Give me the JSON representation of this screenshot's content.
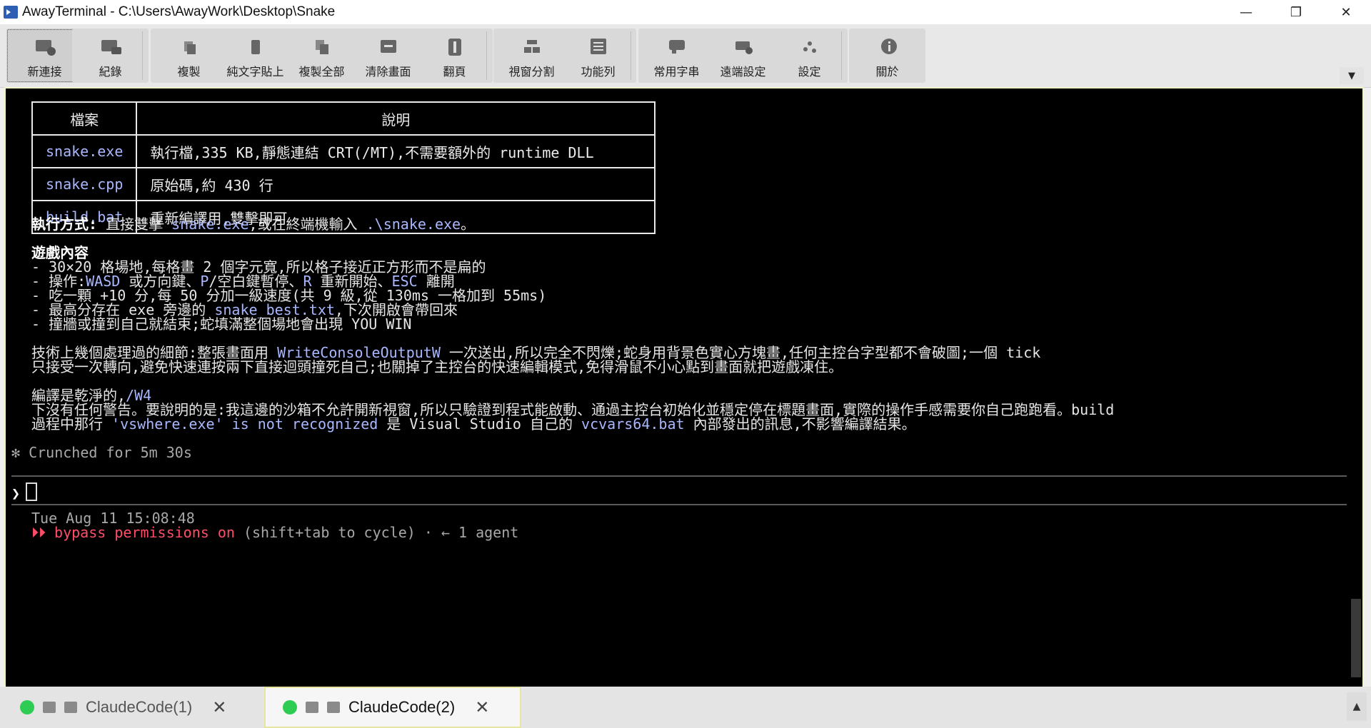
{
  "window": {
    "title": "AwayTerminal - C:\\Users\\AwayWork\\Desktop\\Snake",
    "minimize": "—",
    "restore": "❐",
    "close": "✕"
  },
  "toolbar": {
    "items": [
      {
        "label": "新連接",
        "icon": "new-connection-icon"
      },
      {
        "label": "紀錄",
        "icon": "log-icon"
      },
      {
        "label": "複製",
        "icon": "copy-icon"
      },
      {
        "label": "純文字貼上",
        "icon": "paste-plain-icon"
      },
      {
        "label": "複製全部",
        "icon": "copy-all-icon"
      },
      {
        "label": "清除畫面",
        "icon": "clear-screen-icon"
      },
      {
        "label": "翻頁",
        "icon": "page-flip-icon"
      },
      {
        "label": "視窗分割",
        "icon": "split-window-icon"
      },
      {
        "label": "功能列",
        "icon": "function-bar-icon"
      },
      {
        "label": "常用字串",
        "icon": "snippets-icon"
      },
      {
        "label": "遠端設定",
        "icon": "remote-settings-icon"
      },
      {
        "label": "設定",
        "icon": "settings-icon"
      },
      {
        "label": "關於",
        "icon": "info-icon"
      }
    ],
    "overflow": "▼"
  },
  "terminal": {
    "table": {
      "headers": [
        "檔案",
        "說明"
      ],
      "rows": [
        {
          "file": "snake.exe",
          "desc": "執行檔,335 KB,靜態連結 CRT(/MT),不需要額外的 runtime DLL"
        },
        {
          "file": "snake.cpp",
          "desc": "原始碼,約 430 行"
        },
        {
          "file": "build.bat",
          "desc": "重新編譯用,雙擊即可"
        }
      ]
    },
    "run": {
      "label": "執行方式:",
      "t1": " 直接雙擊 ",
      "c1": "snake.exe",
      "t2": ",或在終端機輸入 ",
      "c2": ".\\snake.exe",
      "t3": "。"
    },
    "game": {
      "heading": "遊戲內容",
      "l1": "- 30×20 格場地,每格畫 2 個字元寬,所以格子接近正方形而不是扁的",
      "l2a": "- 操作:",
      "l2b": "WASD",
      "l2c": " 或方向鍵、",
      "l2d": "P",
      "l2e": "/空白鍵暫停、",
      "l2f": "R",
      "l2g": " 重新開始、",
      "l2h": "ESC",
      "l2i": " 離開",
      "l3": "- 吃一顆 +10 分,每 50 分加一級速度(共 9 級,從 130ms 一格加到 55ms)",
      "l4a": "- 最高分存在 exe 旁邊的 ",
      "l4b": "snake_best.txt",
      "l4c": ",下次開啟會帶回來",
      "l5": "- 撞牆或撞到自己就結束;蛇填滿整個場地會出現 YOU WIN"
    },
    "tech": {
      "a": "技術上幾個處理過的細節:整張畫面用 ",
      "b": "WriteConsoleOutputW",
      "c": " 一次送出,所以完全不閃爍;蛇身用背景色實心方塊畫,任何主控台字型都不會破圖;一個 tick",
      "d": "只接受一次轉向,避免快速連按兩下直接迴頭撞死自己;也關掉了主控台的快速編輯模式,免得滑鼠不小心點到畫面就把遊戲凍住。"
    },
    "compile": {
      "a": "編譯是乾淨的,",
      "b": "/W4",
      "c": "下沒有任何警告。要說明的是:我這邊的沙箱不允許開新視窗,所以只驗證到程式能啟動、通過主控台初始化並穩定停在標題畫面,實際的操作手感需要你自己跑跑看。build",
      "d": "過程中那行 ",
      "e": "'vswhere.exe' is not recognized",
      "f": " 是 Visual Studio 自己的 ",
      "g": "vcvars64.bat",
      "h": " 內部發出的訊息,不影響編譯結果。"
    },
    "status": "✻ Crunched for 5m 30s",
    "prompt": "❯",
    "timestamp": "Tue Aug 11 15:08:48",
    "mode": {
      "arrows": "⏵⏵ ",
      "text": "bypass permissions on",
      "hint": " (shift+tab to cycle) · ← 1 agent"
    }
  },
  "tabs": [
    {
      "label": "ClaudeCode(1)",
      "close": "✕",
      "active": false
    },
    {
      "label": "ClaudeCode(2)",
      "close": "✕",
      "active": true
    }
  ],
  "tab_scroll": "▲"
}
